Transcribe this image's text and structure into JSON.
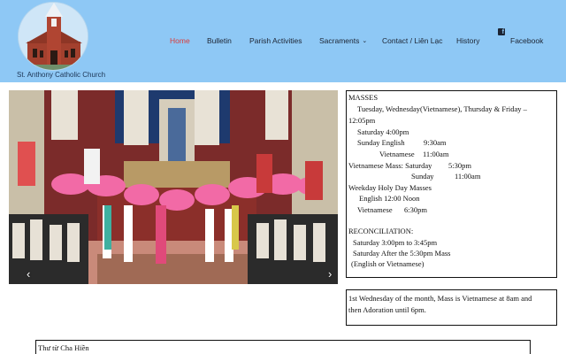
{
  "site": {
    "name": "St. Anthony Catholic Church"
  },
  "nav": {
    "home": "Home",
    "bulletin": "Bulletin",
    "parish_activities": "Parish Activities",
    "sacraments": "Sacraments",
    "contact": "Contact / Liên Lạc",
    "history": "History",
    "facebook": "Facebook",
    "active": "Home",
    "active_color": "#d93d3d"
  },
  "colors": {
    "header_bg": "#8ec8f5",
    "nav_text": "#1c2433"
  },
  "slider": {
    "prev_icon": "chevron-left-icon",
    "next_icon": "chevron-right-icon"
  },
  "masses": {
    "heading": "MASSES",
    "weekday": "Tuesday, Wednesday(Vietnamese), Thursday & Friday –",
    "weekday_time": "12:05pm",
    "saturday": "Saturday 4:00pm",
    "sunday_english_label": "Sunday English",
    "sunday_english_time": "9:30am",
    "sunday_vietnamese_label": "Vietnamese",
    "sunday_vietnamese_time": "11:00am",
    "vn_mass_label": "Vietnamese Mass: Saturday",
    "vn_mass_saturday_time": "5:30pm",
    "vn_mass_sunday_label": "Sunday",
    "vn_mass_sunday_time": "11:00am",
    "holy_day_heading": "Weekday Holy Day Masses",
    "holy_day_english": "English  12:00 Noon",
    "holy_day_vietnamese_label": "Vietnamese",
    "holy_day_vietnamese_time": "6:30pm",
    "reconciliation_heading": "RECONCILIATION:",
    "reconciliation_1": "Saturday 3:00pm to 3:45pm",
    "reconciliation_2": "Saturday After the 5:30pm Mass",
    "reconciliation_3": "(English or Vietnamese)"
  },
  "note": {
    "line1": "1st Wednesday of the month, Mass is Vietnamese at 8am and",
    "line2": "then Adoration until 6pm."
  },
  "letter": {
    "title": "Thư từ Cha Hiền"
  }
}
